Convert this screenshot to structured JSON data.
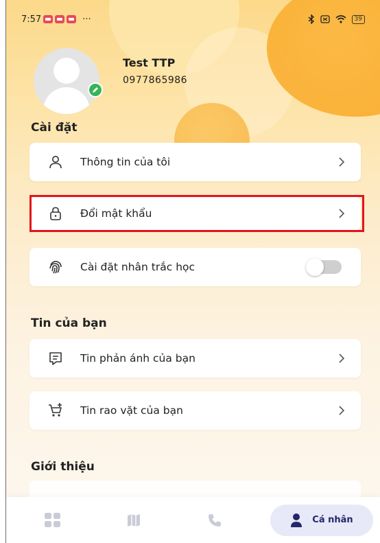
{
  "status_bar": {
    "time": "7:57",
    "more": "···",
    "battery": "39"
  },
  "profile": {
    "name": "Test TTP",
    "phone": "0977865986"
  },
  "sections": {
    "settings_title": "Cài đặt",
    "news_title": "Tin của bạn",
    "about_title": "Giới thiệu"
  },
  "settings_items": [
    {
      "label": "Thông tin của tôi",
      "icon": "user-icon"
    },
    {
      "label": "Đổi mật khẩu",
      "icon": "lock-icon"
    },
    {
      "label": "Cài đặt nhân trắc học",
      "icon": "fingerprint-icon",
      "toggle_on": false
    }
  ],
  "news_items": [
    {
      "label": "Tin phản ánh của bạn",
      "icon": "feedback-message-icon"
    },
    {
      "label": "Tin rao vặt của bạn",
      "icon": "cart-add-icon"
    }
  ],
  "bottom_nav": {
    "items": [
      {
        "icon": "grid-apps-icon"
      },
      {
        "icon": "map-icon"
      },
      {
        "icon": "phone-icon"
      },
      {
        "icon": "person-icon",
        "label": "Cá nhân",
        "active": true
      }
    ],
    "active_color": "#23276b"
  },
  "colors": {
    "highlight": "#e3131b",
    "accent_orange": "#f9a825",
    "edit_badge": "#37b35a"
  }
}
